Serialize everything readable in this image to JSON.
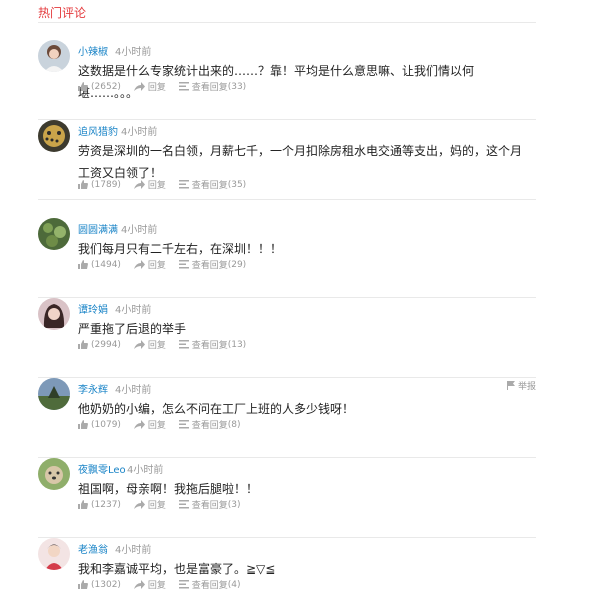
{
  "section_title": "热门评论",
  "comments": [
    {
      "user": "小辣椒",
      "time": "4小时前",
      "text": "这数据是什么专家统计出来的……？靠！平均是什么意思嘛、让我们情以何堪……。。。",
      "likes": "(2652)",
      "reply_label": "回复",
      "view_label": "查看回复",
      "view_count": "(33)"
    },
    {
      "user": "追风猎豹",
      "time": "4小时前",
      "text": "劳资是深圳的一名白领，月薪七千，一个月扣除房租水电交通等支出，妈的，这个月工资又白领了！",
      "likes": "(1789)",
      "reply_label": "回复",
      "view_label": "查看回复",
      "view_count": "(35)"
    },
    {
      "user": "圆圆满满",
      "time": "4小时前",
      "text": "我们每月只有二千左右，在深圳！！！",
      "likes": "(1494)",
      "reply_label": "回复",
      "view_label": "查看回复",
      "view_count": "(29)"
    },
    {
      "user": "谭玲娟",
      "time": "4小时前",
      "text": "严重拖了后退的举手",
      "likes": "(2994)",
      "reply_label": "回复",
      "view_label": "查看回复",
      "view_count": "(13)"
    },
    {
      "user": "李永辉",
      "time": "4小时前",
      "text": "他奶奶的小编，怎么不问在工厂上班的人多少钱呀！",
      "likes": "(1079)",
      "reply_label": "回复",
      "view_label": "查看回复",
      "view_count": "(8)",
      "report": "举报"
    },
    {
      "user": "夜飘零Leo",
      "time": "4小时前",
      "text": "祖国啊，母亲啊！我拖后腿啦！！",
      "likes": "(1237)",
      "reply_label": "回复",
      "view_label": "查看回复",
      "view_count": "(3)"
    },
    {
      "user": "老渔翁",
      "time": "4小时前",
      "text": "我和李嘉诚平均，也是富豪了。≧▽≦",
      "likes": "(1302)",
      "reply_label": "回复",
      "view_label": "查看回复",
      "view_count": "(4)"
    }
  ],
  "colors": {
    "accent": "#e4393c",
    "link": "#1a84c7",
    "muted": "#999999",
    "divider": "#e9e9e9"
  }
}
